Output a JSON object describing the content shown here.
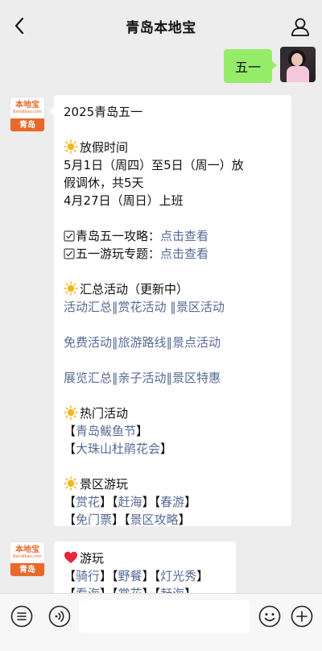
{
  "header": {
    "title": "青岛本地宝"
  },
  "outgoing": {
    "text": "五一"
  },
  "brand": {
    "name": "本地宝",
    "url": "Bendibao.com",
    "city": "青岛"
  },
  "message1": {
    "title": "2025青岛五一",
    "holiday_heading": "放假时间",
    "holiday_line1": "5月1日（周四）至5日（周一）放",
    "holiday_line2": "假调休，共5天",
    "holiday_line3": "4月27日（周日）上班",
    "guide_label": "青岛五一攻略：",
    "guide_link": "点击查看",
    "topic_label": "五一游玩专题：",
    "topic_link": "点击查看",
    "summary_heading": "汇总活动（更新中）",
    "row1": [
      "活动汇总",
      "赏花活动",
      "景区活动"
    ],
    "row2": [
      "免费活动",
      "旅游路线",
      "景点活动"
    ],
    "row3": [
      "展览汇总",
      "亲子活动",
      "景区特惠"
    ],
    "hot_heading": "热门活动",
    "hot_items": [
      "青岛鲅鱼节",
      "大珠山杜鹃花会"
    ],
    "scenic_heading": "景区游玩",
    "scenic_row1": [
      "赏花",
      "赶海",
      "春游"
    ],
    "scenic_row2": [
      "免门票",
      "景区攻略"
    ]
  },
  "message2": {
    "heading": "游玩",
    "row1": [
      "骑行",
      "野餐",
      "灯光秀"
    ],
    "row2": [
      "看海",
      "赏花",
      "赶海"
    ]
  },
  "colors": {
    "link": "#576b95",
    "bubble_out": "#95ec69",
    "brand": "#e8692b"
  }
}
